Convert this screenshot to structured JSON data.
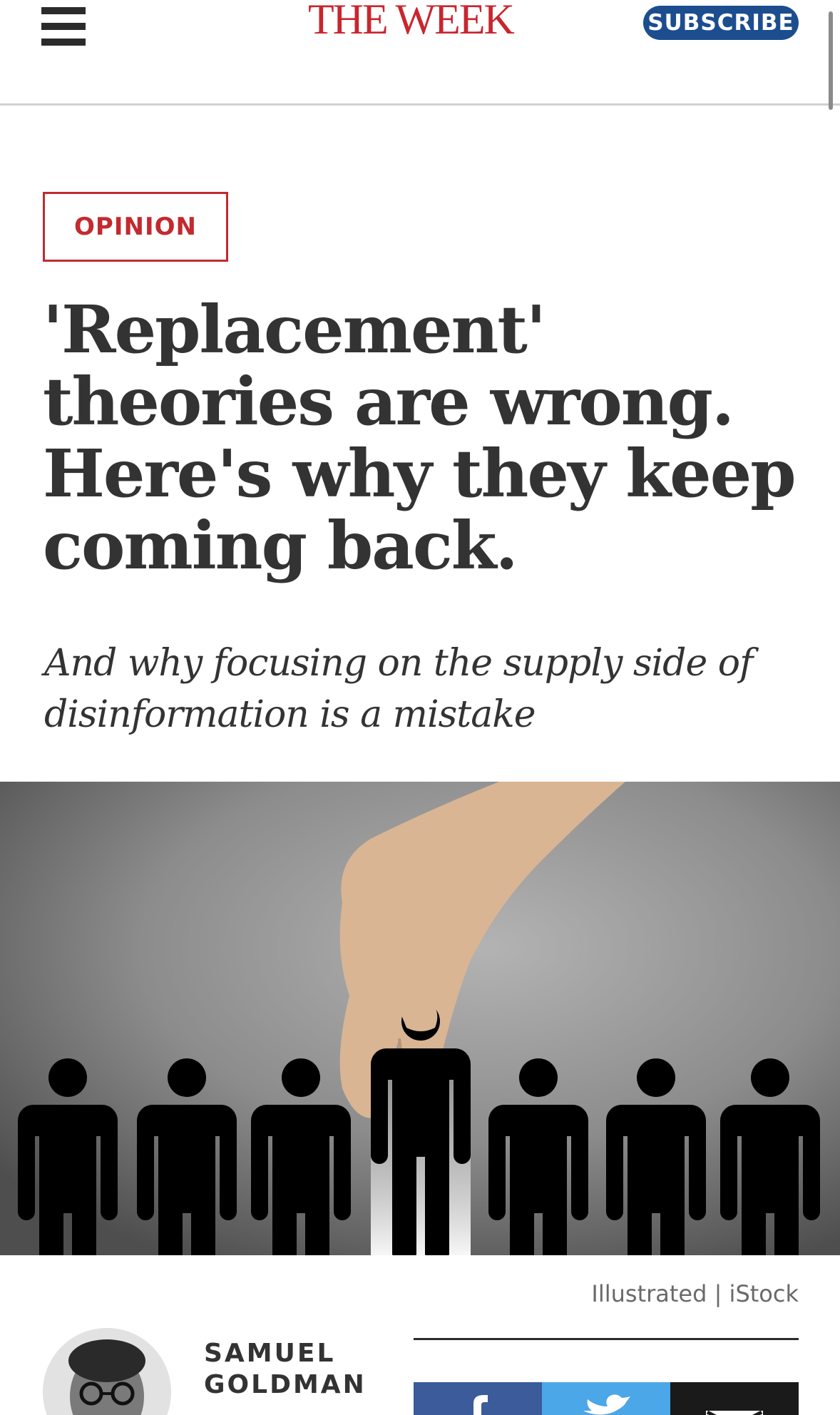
{
  "header": {
    "logo": "THE WEEK",
    "subscribe_label": "SUBSCRIBE",
    "menu_icon": "hamburger-menu-icon"
  },
  "article": {
    "category": "OPINION",
    "headline_lines": [
      "'Replacement'",
      "theories are wrong.",
      "Here's why they keep",
      "coming back."
    ],
    "dek_lines": [
      "And why focusing on the supply side of",
      "disinformation is a mistake"
    ],
    "image_credit": "Illustrated | iStock",
    "author_lines": [
      "SAMUEL",
      "GOLDMAN"
    ]
  },
  "share": {
    "facebook_icon": "facebook-icon",
    "twitter_icon": "twitter-icon",
    "email_icon": "email-icon"
  },
  "colors": {
    "brand_red": "#c8262e",
    "subscribe_blue": "#1c4d8f",
    "facebook_blue": "#3b5b9a",
    "twitter_blue": "#4ba7e8",
    "text_dark": "#333333"
  }
}
